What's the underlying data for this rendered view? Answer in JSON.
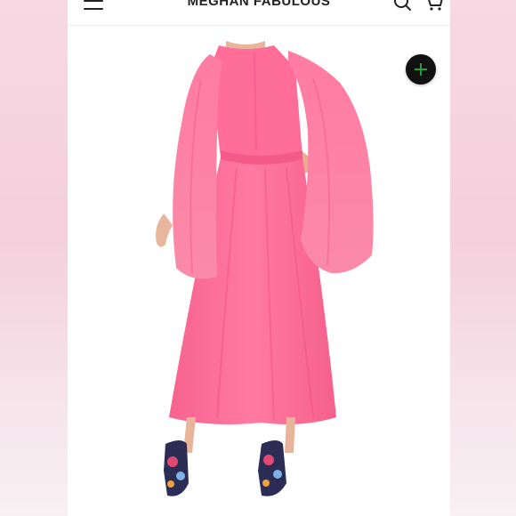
{
  "header": {
    "menu_icon": "hamburger-menu-icon",
    "brand": "MEGHAN FABULOUS",
    "search_icon": "search-icon",
    "cart_icon": "cart-icon"
  },
  "product_image": {
    "zoom_icon": "plus-icon",
    "dress_color": "#ff6f9a"
  }
}
